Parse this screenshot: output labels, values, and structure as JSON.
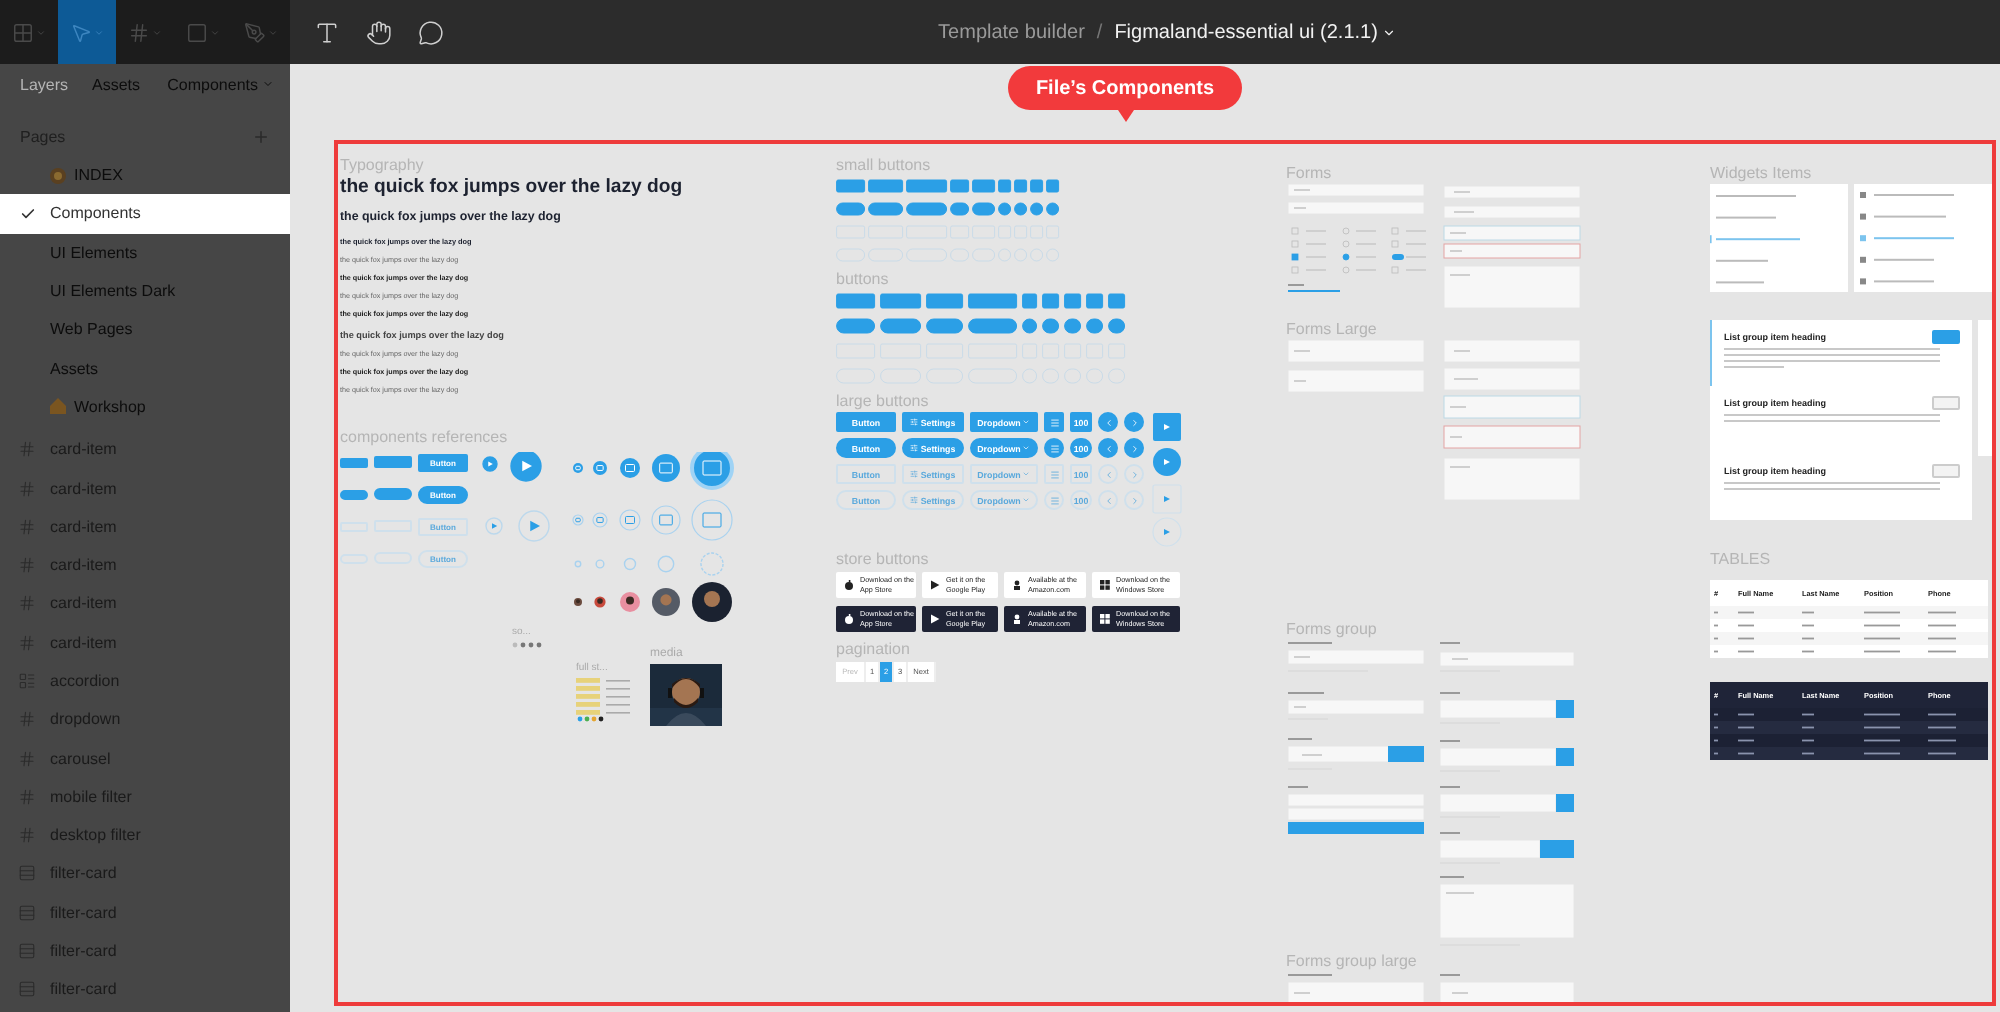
{
  "toolbar": {
    "tools": [
      {
        "kind": "menu",
        "selected": false
      },
      {
        "kind": "move",
        "selected": true
      },
      {
        "kind": "frame",
        "selected": false
      },
      {
        "kind": "shape",
        "selected": false
      },
      {
        "kind": "pen",
        "selected": false
      }
    ],
    "actions": [
      {
        "kind": "text"
      },
      {
        "kind": "hand"
      },
      {
        "kind": "comment"
      }
    ],
    "breadcrumb": {
      "parent": "Template builder",
      "separator": "/",
      "file": "Figmaland-essential ui (2.1.1)"
    }
  },
  "sidebar": {
    "tabs": [
      {
        "label": "Layers",
        "selected": true
      },
      {
        "label": "Assets",
        "selected": false
      }
    ],
    "page_menu": "Components",
    "pages_title": "Pages",
    "pages": [
      {
        "label": "INDEX",
        "selected": false
      },
      {
        "label": "Components",
        "selected": true
      },
      {
        "label": "UI Elements",
        "selected": false
      },
      {
        "label": "UI Elements Dark",
        "selected": false
      },
      {
        "label": "Web Pages",
        "selected": false
      },
      {
        "label": "Assets",
        "selected": false
      },
      {
        "label": "Workshop",
        "selected": false
      }
    ],
    "layers": [
      {
        "label": "card-item",
        "kind": "frame"
      },
      {
        "label": "card-item",
        "kind": "frame"
      },
      {
        "label": "card-item",
        "kind": "frame"
      },
      {
        "label": "card-item",
        "kind": "frame"
      },
      {
        "label": "card-item",
        "kind": "frame"
      },
      {
        "label": "card-item",
        "kind": "frame"
      },
      {
        "label": "accordion",
        "kind": "section"
      },
      {
        "label": "dropdown",
        "kind": "frame"
      },
      {
        "label": "carousel",
        "kind": "frame"
      },
      {
        "label": "mobile filter",
        "kind": "frame"
      },
      {
        "label": "desktop filter",
        "kind": "frame"
      },
      {
        "label": "filter-card",
        "kind": "stack"
      },
      {
        "label": "filter-card",
        "kind": "stack"
      },
      {
        "label": "filter-card",
        "kind": "stack"
      },
      {
        "label": "filter-card",
        "kind": "stack"
      }
    ]
  },
  "canvas": {
    "callout": "File’s Components",
    "typography": {
      "title": "Typography",
      "lines": [
        {
          "text": "the quick fox jumps over the lazy dog",
          "kind": "xl"
        },
        {
          "text": "the quick fox jumps over the lazy dog",
          "kind": "lg"
        },
        {
          "text": "the quick fox jumps over the lazy dog",
          "kind": "sm"
        },
        {
          "text": "the quick fox jumps over the lazy dog",
          "kind": "xs"
        },
        {
          "text": "the quick fox jumps over the lazy dog",
          "kind": "xsb"
        },
        {
          "text": "the quick fox jumps over the lazy dog",
          "kind": "xs"
        },
        {
          "text": "the quick fox jumps over the lazy dog",
          "kind": "xsb"
        },
        {
          "text": "the quick fox jumps over the lazy dog",
          "kind": "md"
        },
        {
          "text": "the quick fox jumps over the lazy dog",
          "kind": "xs"
        },
        {
          "text": "the quick fox jumps over the lazy dog",
          "kind": "xsb"
        },
        {
          "text": "the quick fox jumps over the lazy dog",
          "kind": "xs"
        }
      ]
    },
    "references": {
      "title": "components references",
      "buttons": [
        {
          "kind": "filled",
          "label": "Button"
        },
        {
          "kind": "pill",
          "label": "Button"
        },
        {
          "kind": "outline",
          "label": "Button"
        },
        {
          "kind": "outline-pill",
          "label": "Button"
        }
      ],
      "socials_title": "so...",
      "thumbnail_title": "full st...",
      "media_title": "media"
    },
    "buttons": {
      "small_title": "small buttons",
      "regular_title": "buttons",
      "large_title": "large buttons",
      "large_rows": [
        {
          "kind": "filled",
          "labels": [
            "Button",
            "Settings",
            "Dropdown",
            "100"
          ]
        },
        {
          "kind": "pill",
          "labels": [
            "Button",
            "Settings",
            "Dropdown",
            "100"
          ]
        },
        {
          "kind": "outline",
          "labels": [
            "Button",
            "Settings",
            "Dropdown",
            "100"
          ]
        },
        {
          "kind": "outline-pill",
          "labels": [
            "Button",
            "Settings",
            "Dropdown",
            "100"
          ]
        }
      ],
      "store_title": "store buttons",
      "store_rows": [
        {
          "kind": "light",
          "items": [
            {
              "top": "Download on the",
              "bottom": "App Store"
            },
            {
              "top": "Get it on the",
              "bottom": "Google Play"
            },
            {
              "top": "Available at the",
              "bottom": "Amazon.com"
            },
            {
              "top": "Download on the",
              "bottom": "Windows Store"
            }
          ]
        },
        {
          "kind": "dark",
          "items": [
            {
              "top": "Download on the",
              "bottom": "App Store"
            },
            {
              "top": "Get it on the",
              "bottom": "Google Play"
            },
            {
              "top": "Available at the",
              "bottom": "Amazon.com"
            },
            {
              "top": "Download on the",
              "bottom": "Windows Store"
            }
          ]
        }
      ],
      "pagination_title": "pagination",
      "pages": [
        {
          "label": "Prev",
          "selected": false,
          "disabled": true
        },
        {
          "label": "1",
          "selected": false,
          "disabled": false
        },
        {
          "label": "2",
          "selected": true,
          "disabled": false
        },
        {
          "label": "3",
          "selected": false,
          "disabled": false
        },
        {
          "label": "Next",
          "selected": false,
          "disabled": false
        }
      ]
    },
    "forms": [
      {
        "title": "Forms",
        "kind": "basic"
      },
      {
        "title": "Forms Large",
        "kind": "large"
      },
      {
        "title": "Forms group",
        "kind": "group"
      },
      {
        "title": "Forms group large",
        "kind": "group-large"
      }
    ],
    "widgets": {
      "title": "Widgets Items",
      "list_group": [
        {
          "heading": "List group item heading",
          "selected": true
        },
        {
          "heading": "List group item heading",
          "selected": false
        },
        {
          "heading": "List group item heading",
          "selected": false
        }
      ],
      "tables_title": "TABLES",
      "tables": [
        {
          "kind": "light",
          "columns": [
            "#",
            "Full Name",
            "Last Name",
            "Position",
            "Phone"
          ]
        },
        {
          "kind": "dark",
          "columns": [
            "#",
            "Full Name",
            "Last Name",
            "Position",
            "Phone"
          ]
        }
      ]
    }
  }
}
